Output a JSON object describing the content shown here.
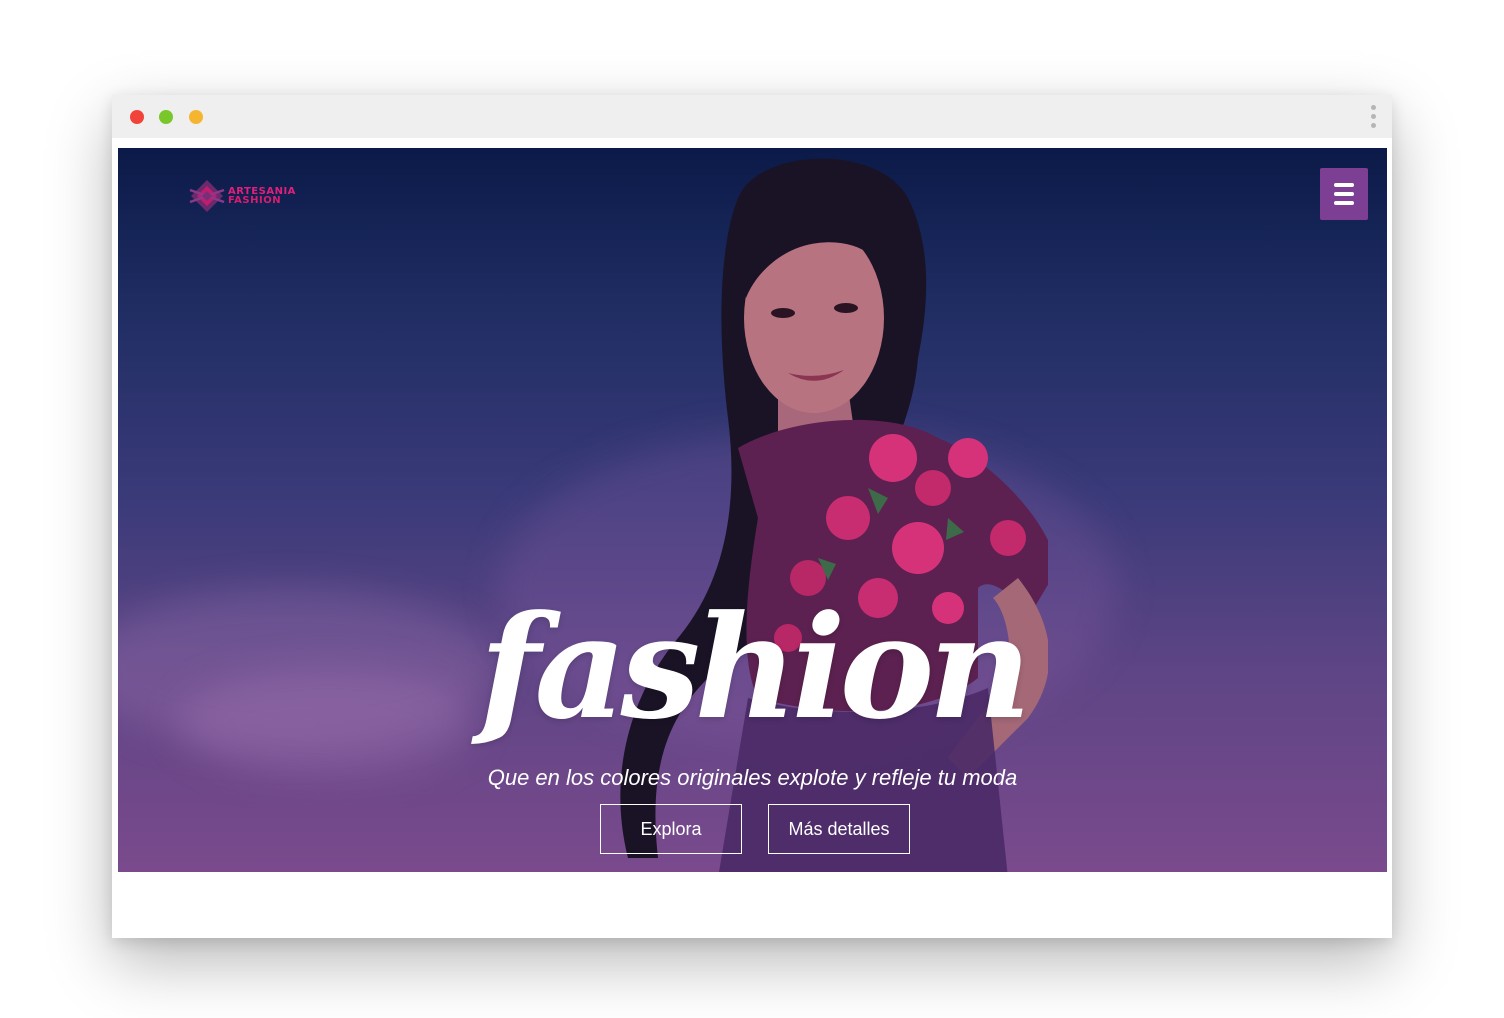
{
  "window": {
    "traffic_lights": [
      "close",
      "minimize",
      "maximize"
    ],
    "menu_icon": "kebab-menu-icon"
  },
  "brand": {
    "line1": "ARTESANIA",
    "line2": "FASHION",
    "logo_icon": "diamond-logo-icon",
    "logo_color": "#e0207a"
  },
  "nav": {
    "menu_icon": "hamburger-icon",
    "menu_color": "#7d3f93"
  },
  "hero": {
    "title": "fashion",
    "tagline": "Que en los colores originales explote y refleje tu moda",
    "buttons": [
      {
        "label": "Explora"
      },
      {
        "label": "Más detalles"
      }
    ],
    "background_top": "#0b1a48",
    "background_bottom": "#7a4a8d"
  }
}
